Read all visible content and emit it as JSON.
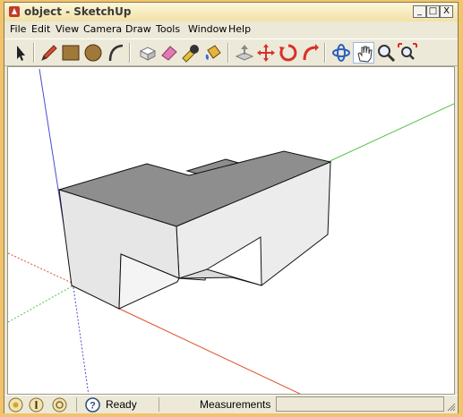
{
  "window": {
    "title": "object - SketchUp",
    "buttons": {
      "minimize": "_",
      "maximize": "□",
      "close": "X"
    }
  },
  "menu": {
    "items": [
      {
        "label": "File"
      },
      {
        "label": "Edit"
      },
      {
        "label": "View"
      },
      {
        "label": "Camera"
      },
      {
        "label": "Draw"
      },
      {
        "label": "Tools"
      },
      {
        "label": "Window"
      },
      {
        "label": "Help"
      }
    ]
  },
  "toolbar": {
    "tools": [
      {
        "name": "select-tool",
        "icon": "arrow-cursor-icon"
      },
      {
        "name": "pencil-tool",
        "icon": "pencil-icon"
      },
      {
        "name": "rectangle-tool",
        "icon": "rectangle-icon"
      },
      {
        "name": "circle-tool",
        "icon": "circle-icon"
      },
      {
        "name": "arc-tool",
        "icon": "arc-icon"
      },
      {
        "name": "make-component-tool",
        "icon": "component-icon"
      },
      {
        "name": "eraser-tool",
        "icon": "eraser-icon"
      },
      {
        "name": "tape-measure-tool",
        "icon": "tape-measure-icon"
      },
      {
        "name": "paint-bucket-tool",
        "icon": "paint-bucket-icon"
      },
      {
        "name": "push-pull-tool",
        "icon": "push-pull-icon"
      },
      {
        "name": "move-tool",
        "icon": "move-icon"
      },
      {
        "name": "rotate-tool",
        "icon": "rotate-icon"
      },
      {
        "name": "follow-me-tool",
        "icon": "follow-me-icon"
      },
      {
        "name": "orbit-tool",
        "icon": "orbit-icon"
      },
      {
        "name": "pan-tool",
        "icon": "hand-icon",
        "active": true
      },
      {
        "name": "zoom-tool",
        "icon": "magnifier-icon"
      },
      {
        "name": "zoom-extents-tool",
        "icon": "zoom-extents-icon"
      }
    ]
  },
  "statusbar": {
    "status_text": "Ready",
    "measurements_label": "Measurements",
    "measurements_value": ""
  },
  "colors": {
    "red_axis": "#e0502a",
    "green_axis": "#55c24a",
    "blue_axis": "#4b4bd0",
    "top_face": "#8e8e8e",
    "side_face": "#ececec",
    "frame": "#f2c36a"
  }
}
